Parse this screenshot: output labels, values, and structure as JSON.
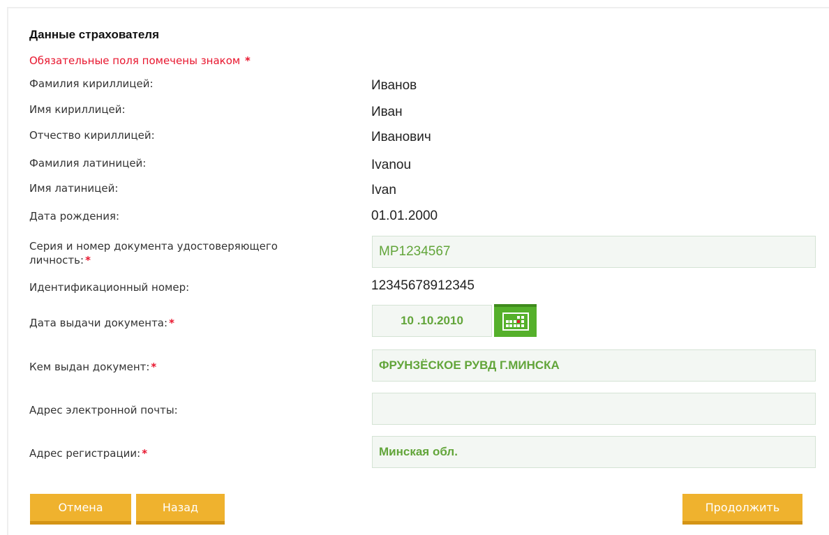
{
  "form": {
    "title": "Данные страхователя",
    "required_note": "Обязательные поля помечены знаком",
    "required_mark": "*",
    "surname_cyr": {
      "label": "Фамилия кириллицей:",
      "value": "Иванов"
    },
    "name_cyr": {
      "label": "Имя кириллицей:",
      "value": "Иван"
    },
    "patronymic_cyr": {
      "label": "Отчество кириллицей:",
      "value": "Иванович"
    },
    "surname_lat": {
      "label": "Фамилия латиницей:",
      "value": "Ivanou"
    },
    "name_lat": {
      "label": "Имя латиницей:",
      "value": "Ivan"
    },
    "birth_date": {
      "label": "Дата рождения:",
      "value": "01.01.2000"
    },
    "doc_number": {
      "label_line1": "Серия и номер документа удостоверяющего",
      "label_line2": "личность:",
      "value": "MP1234567"
    },
    "id_number": {
      "label": "Идентификационный номер:",
      "value": "12345678912345"
    },
    "issue_date": {
      "label": "Дата выдачи документа:",
      "value": "10 .10.2010",
      "icon": "calendar-icon"
    },
    "issued_by": {
      "label": "Кем выдан документ:",
      "value": "ФРУНЗЁСКОЕ РУВД Г.МИНСКА"
    },
    "email": {
      "label": "Адрес электронной почты:",
      "value": ""
    },
    "registration_address": {
      "label": "Адрес регистрации:",
      "value": "Минская обл."
    }
  },
  "buttons": {
    "cancel": "Отмена",
    "back": "Назад",
    "continue": "Продолжить"
  },
  "colors": {
    "required": "#e8162e",
    "field_text": "#62a53a",
    "field_bg": "#f3f7f3",
    "calendar_button": "#55b02b",
    "button_bg": "#efb22e"
  }
}
